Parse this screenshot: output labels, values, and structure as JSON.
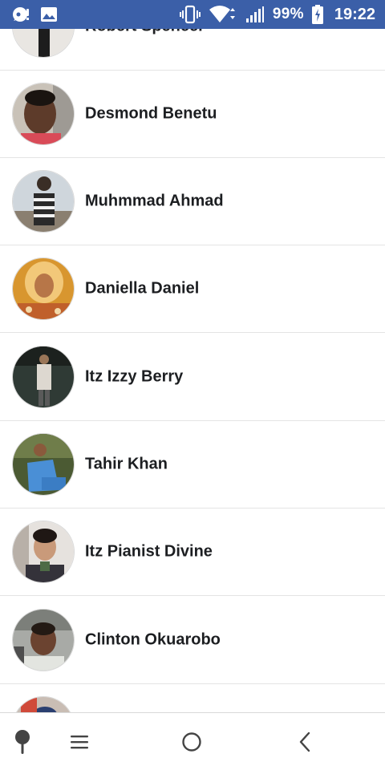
{
  "status_bar": {
    "battery_text": "99%",
    "time": "19:22",
    "icons": [
      "notification-icon",
      "image-icon",
      "vibrate-icon",
      "wifi-icon",
      "signal-icon",
      "battery-icon"
    ]
  },
  "contacts": [
    {
      "name": "Robert Spencer",
      "avatar": "avatar-photo"
    },
    {
      "name": "Desmond Benetu",
      "avatar": "avatar-photo"
    },
    {
      "name": "Muhmmad Ahmad",
      "avatar": "avatar-photo"
    },
    {
      "name": "Daniella Daniel",
      "avatar": "avatar-photo"
    },
    {
      "name": "Itz Izzy Berry",
      "avatar": "avatar-photo"
    },
    {
      "name": "Tahir Khan",
      "avatar": "avatar-photo"
    },
    {
      "name": "Itz Pianist Divine",
      "avatar": "avatar-photo"
    },
    {
      "name": "Clinton Okuarobo",
      "avatar": "avatar-photo"
    },
    {
      "name": "",
      "avatar": "avatar-photo"
    }
  ],
  "nav_bar": {
    "icons": [
      "pin-icon",
      "menu-icon",
      "home-icon",
      "back-icon"
    ]
  },
  "colors": {
    "status_bar": "#3b5fa8",
    "divider": "#e4e4e4",
    "name_text": "#1c1e21"
  }
}
